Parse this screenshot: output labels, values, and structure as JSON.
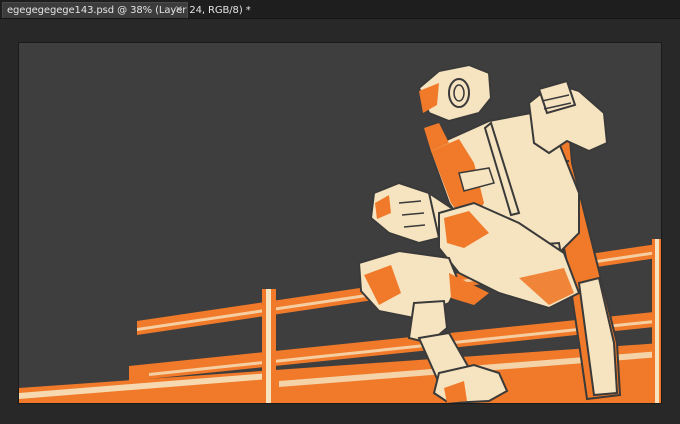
{
  "document_tab": {
    "title": "egegegegege143.psd @ 38% (Layer 24, RGB/8) *",
    "close_glyph": "×"
  },
  "colors": {
    "canvas_background": "#3e3e3e",
    "accent_orange": "#f07a2a",
    "cream": "#f6e3bf",
    "outline": "#3a3a3a"
  },
  "artwork": {
    "subject": "illustration-of-seated-figure-with-baseball-bat-on-fence"
  }
}
